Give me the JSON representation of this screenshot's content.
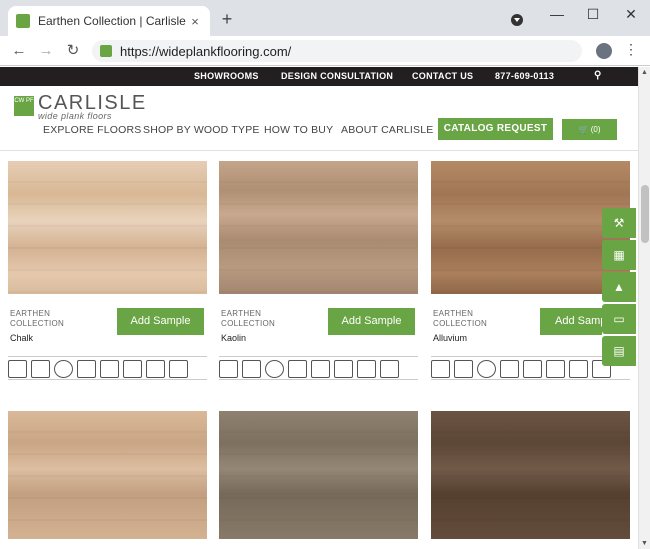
{
  "browser": {
    "tab_title": "Earthen Collection | Carlisle Wide",
    "tab_close": "×",
    "new_tab": "+",
    "url": "https://wideplankflooring.com/",
    "back": "←",
    "forward": "→",
    "reload": "↻",
    "minimize": "—",
    "maximize": "☐",
    "close": "✕",
    "menu": "⋮"
  },
  "site": {
    "topbar": {
      "showrooms": "SHOWROOMS",
      "design_consultation": "DESIGN CONSULTATION",
      "contact_us": "CONTACT US",
      "phone": "877-609-0113",
      "search_icon": "⚲"
    },
    "logo": {
      "mark": "CW PF",
      "name": "CARLISLE",
      "tagline": "wide plank floors"
    },
    "nav": {
      "explore": "EXPLORE FLOORS",
      "shop": "SHOP BY WOOD TYPE",
      "how_to_buy": "HOW TO BUY",
      "about": "ABOUT CARLISLE",
      "catalog": "CATALOG REQUEST",
      "cart": "🛒  (0)"
    },
    "accent_color": "#69a544",
    "products": [
      {
        "collection": "EARTHEN\nCOLLECTION",
        "name": "Chalk",
        "button": "Add Sample"
      },
      {
        "collection": "EARTHEN\nCOLLECTION",
        "name": "Kaolin",
        "button": "Add Sample"
      },
      {
        "collection": "EARTHEN\nCOLLECTION",
        "name": "Alluvium",
        "button": "Add Sample"
      }
    ],
    "side_tools": [
      "hammer-icon",
      "grid-icon",
      "tree-icon",
      "book-icon",
      "document-icon"
    ]
  }
}
